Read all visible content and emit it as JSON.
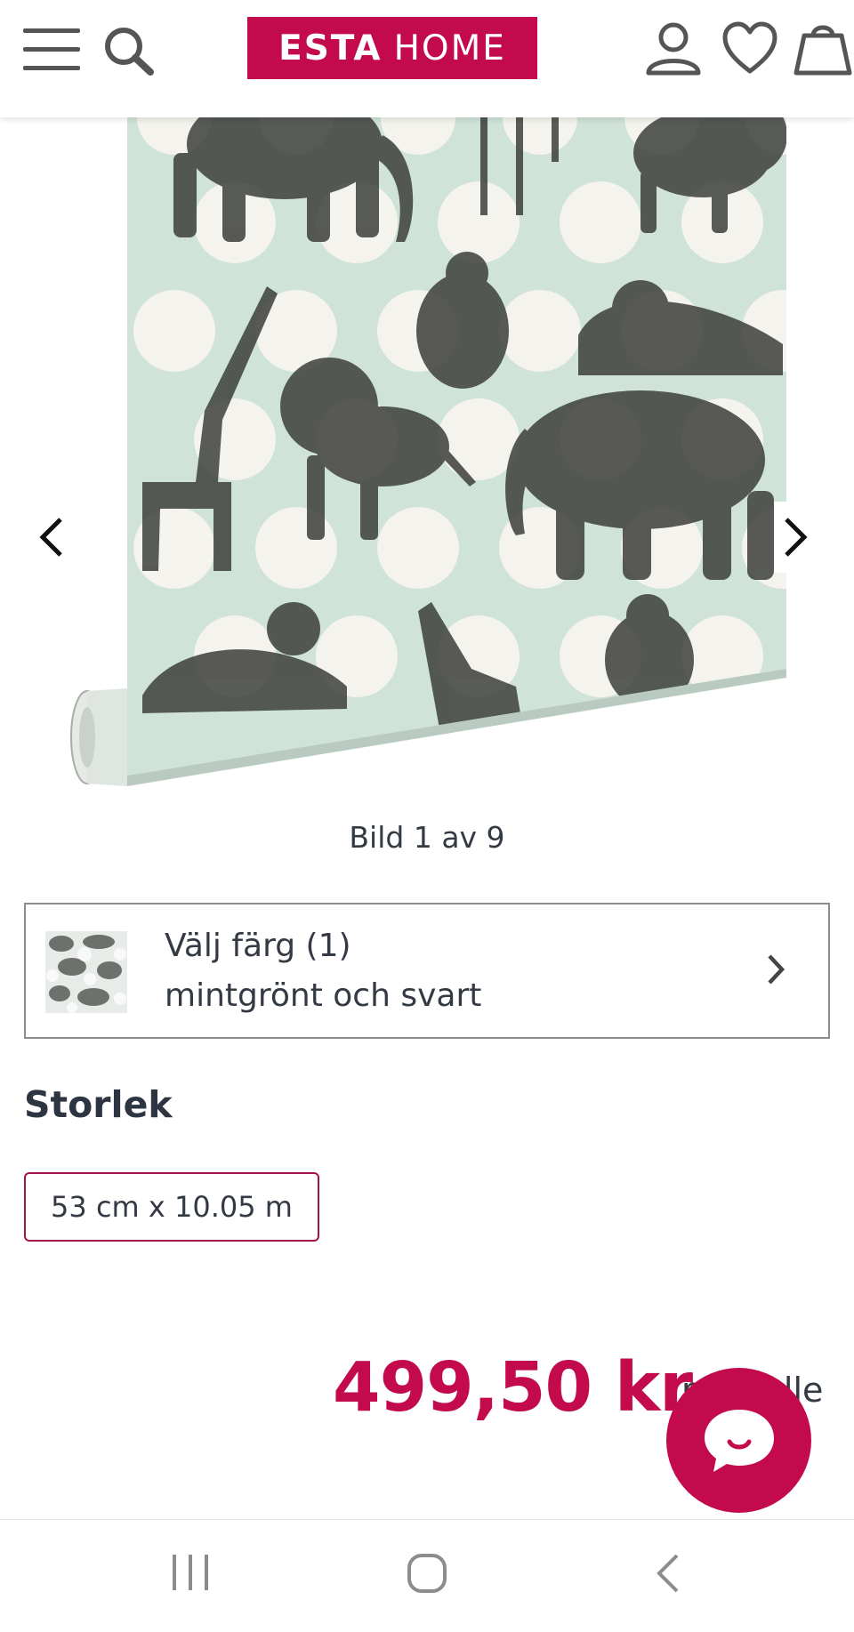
{
  "header": {
    "logo_bold": "ESTA",
    "logo_light": "HOME",
    "icons": [
      "menu-icon",
      "search-icon",
      "account-icon",
      "wishlist-heart-icon",
      "cart-bag-icon"
    ]
  },
  "gallery": {
    "counter": "Bild 1 av 9",
    "prev_icon": "chevron-left-icon",
    "next_icon": "chevron-right-icon"
  },
  "color": {
    "title": "Välj färg (1)",
    "value": "mintgrönt och svart"
  },
  "size": {
    "heading": "Storlek",
    "option": "53 cm x 10.05 m"
  },
  "price": {
    "amount": "499,50 kr",
    "unit_visible": "per rulle"
  },
  "colors": {
    "brand": "#c20a4d",
    "mint": "#cfe3d8",
    "text": "#333a44"
  },
  "system_nav": [
    "recents-icon",
    "home-icon",
    "back-icon"
  ]
}
